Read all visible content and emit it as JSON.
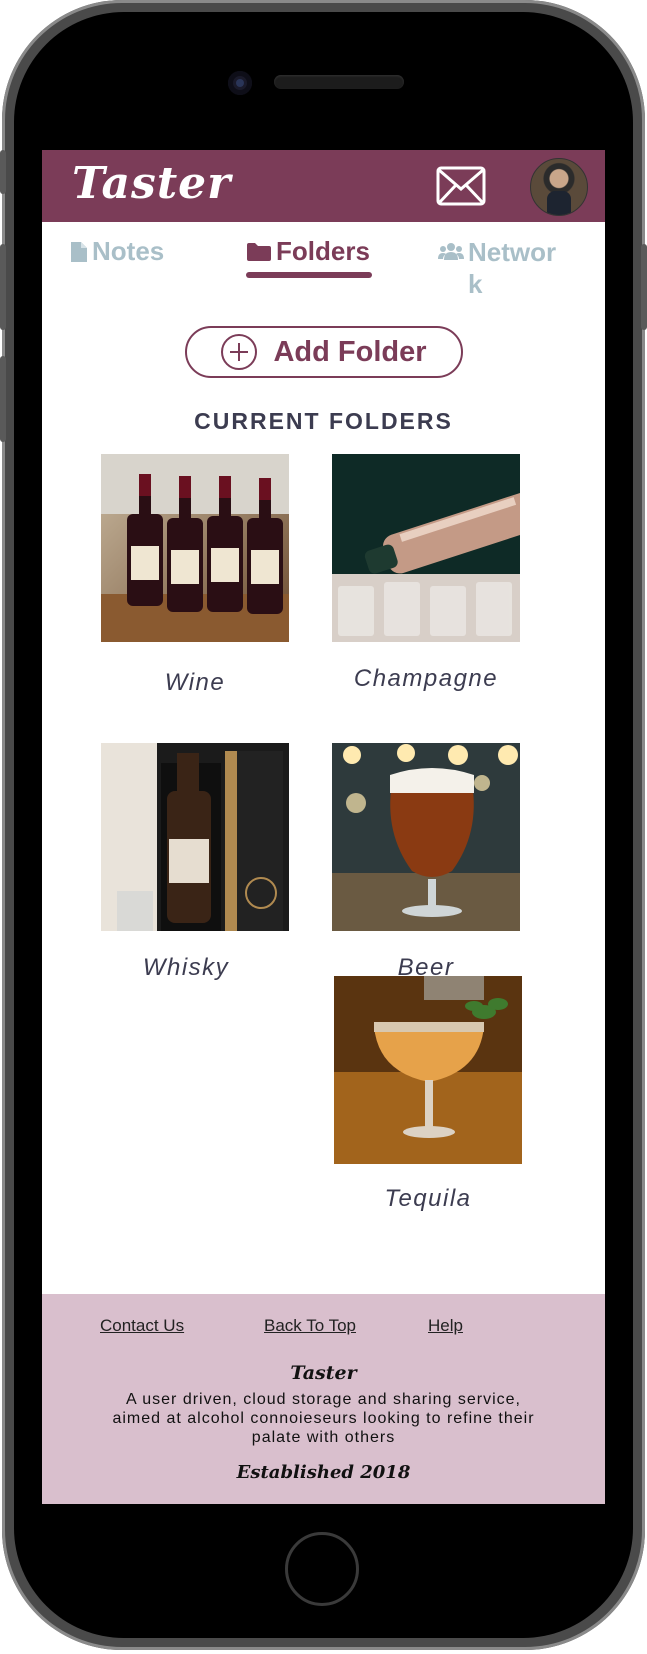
{
  "app": {
    "logo_text": "Taster"
  },
  "tabs": [
    {
      "label": "Notes",
      "icon": "file-icon"
    },
    {
      "label": "Folders",
      "icon": "folder-icon",
      "active": true
    },
    {
      "label": "Networ k",
      "icon": "users-icon"
    }
  ],
  "actions": {
    "add_folder_label": "Add Folder"
  },
  "section": {
    "title": "CURRENT FOLDERS"
  },
  "folders": [
    {
      "name": "Wine"
    },
    {
      "name": "Champagne"
    },
    {
      "name": "Whisky"
    },
    {
      "name": "Beer"
    },
    {
      "name": "Tequila"
    }
  ],
  "footer": {
    "links": [
      "Contact Us",
      "Back To Top",
      "Help"
    ],
    "brand": "Taster",
    "description": "A user driven, cloud storage and sharing service, aimed at alcohol connoieseurs looking to refine their palate with others",
    "established": "Established 2018"
  },
  "colors": {
    "brand": "#7b3c58",
    "inactive_tab": "#a9bfc8",
    "footer_bg": "#d9bfcd",
    "text_dark": "#3c3c50"
  }
}
